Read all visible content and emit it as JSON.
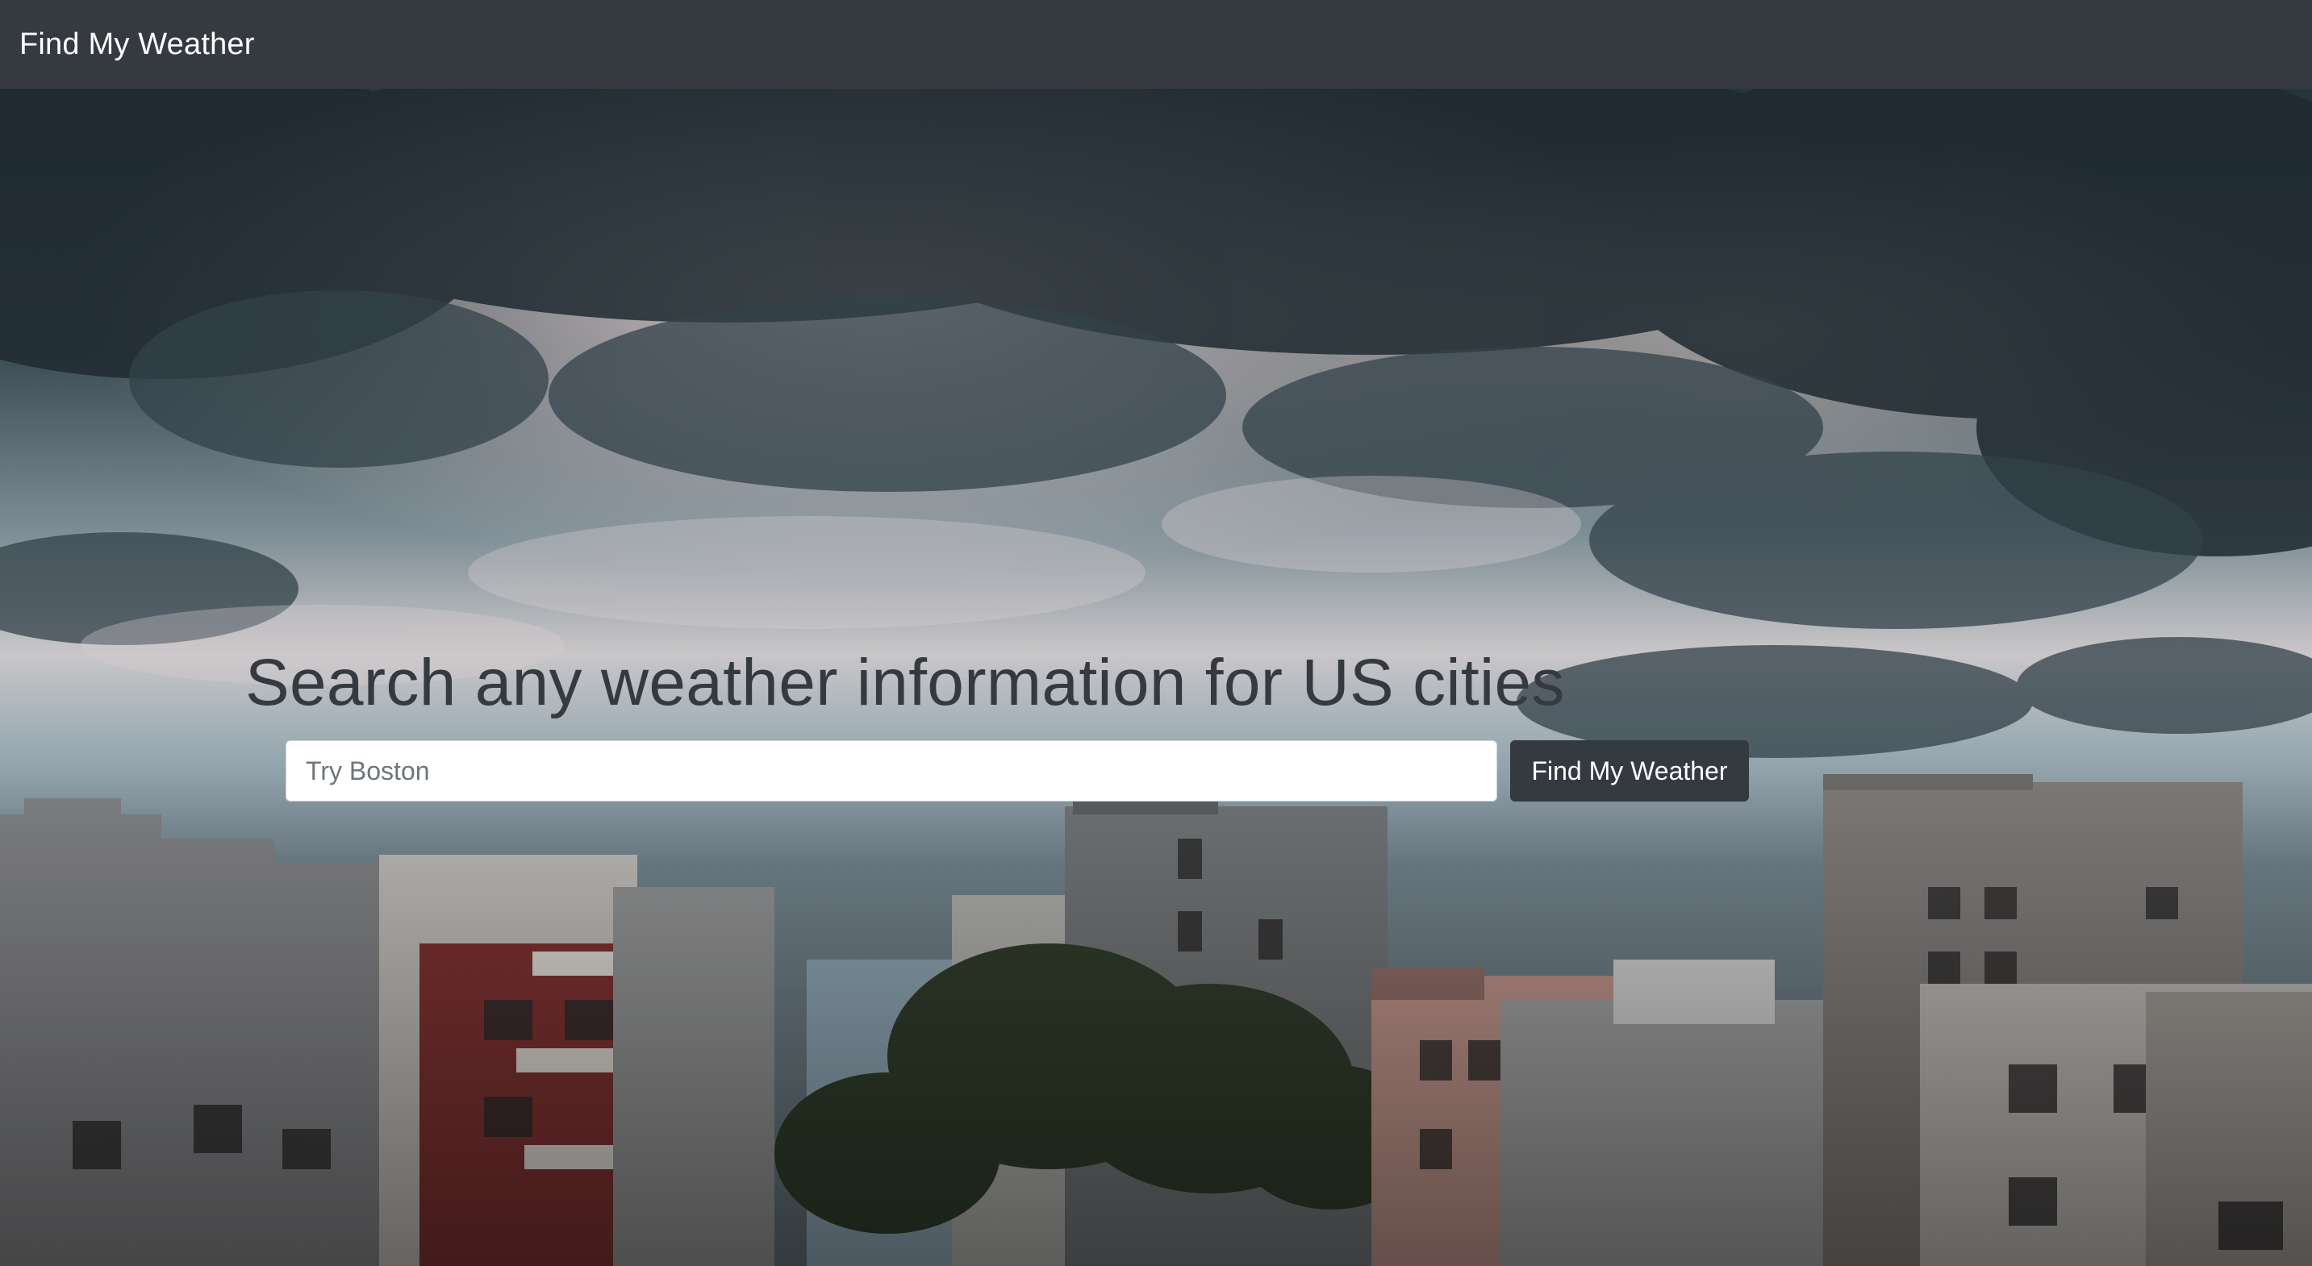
{
  "navbar": {
    "brand": "Find My Weather"
  },
  "hero": {
    "background": "stormy-sky-over-city-rooftops-photo",
    "headline": "Search any weather information for US cities",
    "search": {
      "placeholder": "Try Boston",
      "value": ""
    },
    "button_label": "Find My Weather"
  },
  "colors": {
    "navbar_bg": "#343a40",
    "button_bg": "#343a40",
    "headline": "#343a40"
  }
}
